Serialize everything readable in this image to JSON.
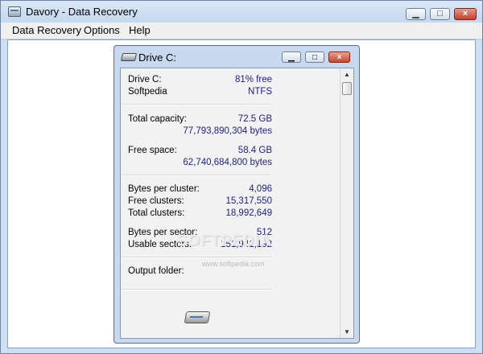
{
  "window": {
    "title": "Davory - Data Recovery",
    "buttons": [
      "minimize-icon",
      "maximize-icon",
      "close-icon"
    ]
  },
  "menu": {
    "items": [
      "Data Recovery",
      "Options",
      "Help"
    ]
  },
  "child_window": {
    "title": "Drive C:",
    "rows": {
      "drive_label": "Drive C:",
      "drive_value": "81% free",
      "fs_label": "Softpedia",
      "fs_value": "NTFS",
      "total_capacity_label": "Total capacity:",
      "total_capacity_gb": "72.5 GB",
      "total_capacity_bytes": "77,793,890,304 bytes",
      "free_space_label": "Free space:",
      "free_space_gb": "58.4 GB",
      "free_space_bytes": "62,740,684,800 bytes",
      "bytes_per_cluster_label": "Bytes per cluster:",
      "bytes_per_cluster_value": "4,096",
      "free_clusters_label": "Free clusters:",
      "free_clusters_value": "15,317,550",
      "total_clusters_label": "Total clusters:",
      "total_clusters_value": "18,992,649",
      "bytes_per_sector_label": "Bytes per sector:",
      "bytes_per_sector_value": "512",
      "usable_sectors_label": "Usable sectors:",
      "usable_sectors_value": "151,941,192",
      "output_folder_label": "Output folder:"
    }
  },
  "watermark": {
    "text": "SOFTPEDIA",
    "subtext": "www.softpedia.com"
  }
}
